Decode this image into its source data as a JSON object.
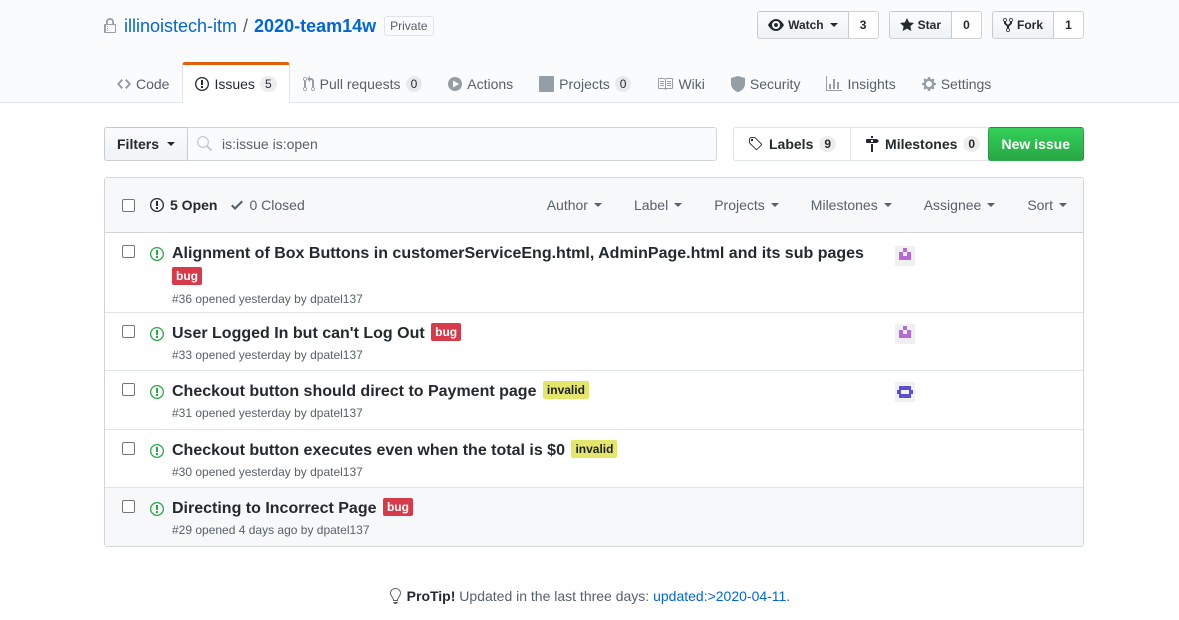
{
  "repo": {
    "owner": "illinoistech-itm",
    "separator": "/",
    "name": "2020-team14w",
    "visibility": "Private"
  },
  "actions": {
    "watch": {
      "label": "Watch",
      "count": "3"
    },
    "star": {
      "label": "Star",
      "count": "0"
    },
    "fork": {
      "label": "Fork",
      "count": "1"
    }
  },
  "tabs": [
    {
      "label": "Code",
      "icon": "code-icon"
    },
    {
      "label": "Issues",
      "count": "5",
      "icon": "issue-opened-icon",
      "selected": true
    },
    {
      "label": "Pull requests",
      "count": "0",
      "icon": "git-pull-request-icon"
    },
    {
      "label": "Actions",
      "icon": "play-icon"
    },
    {
      "label": "Projects",
      "count": "0",
      "icon": "project-icon"
    },
    {
      "label": "Wiki",
      "icon": "book-icon"
    },
    {
      "label": "Security",
      "icon": "shield-icon"
    },
    {
      "label": "Insights",
      "icon": "graph-icon"
    },
    {
      "label": "Settings",
      "icon": "gear-icon"
    }
  ],
  "subnav": {
    "filters_label": "Filters",
    "search_value": "is:issue is:open",
    "labels": {
      "label": "Labels",
      "count": "9"
    },
    "milestones": {
      "label": "Milestones",
      "count": "0"
    },
    "new_issue": "New issue"
  },
  "box_header": {
    "open": "5 Open",
    "closed": "0 Closed",
    "menus": [
      "Author",
      "Label",
      "Projects",
      "Milestones",
      "Assignee",
      "Sort"
    ]
  },
  "issues": [
    {
      "title": "Alignment of Box Buttons in customerServiceEng.html, AdminPage.html and its sub pages",
      "label": "bug",
      "meta": "#36 opened yesterday by dpatel137",
      "avatar": "purple"
    },
    {
      "title": "User Logged In but can't Log Out",
      "label": "bug",
      "meta": "#33 opened yesterday by dpatel137",
      "avatar": "purple"
    },
    {
      "title": "Checkout button should direct to Payment page",
      "label": "invalid",
      "meta": "#31 opened yesterday by dpatel137",
      "avatar": "blue"
    },
    {
      "title": "Checkout button executes even when the total is $0",
      "label": "invalid",
      "meta": "#30 opened yesterday by dpatel137",
      "avatar": ""
    },
    {
      "title": "Directing to Incorrect Page",
      "label": "bug",
      "meta": "#29 opened 4 days ago by dpatel137",
      "avatar": ""
    }
  ],
  "protip": {
    "strong": "ProTip!",
    "text": " Updated in the last three days: ",
    "link": "updated:>2020-04-11",
    "end": "."
  },
  "colors": {
    "link": "#0366d6",
    "bug": "#d73a4a",
    "invalid": "#e4e669",
    "open_green": "#28a745",
    "new_issue_green": "#2ea44f",
    "tab_accent": "#e36209"
  }
}
